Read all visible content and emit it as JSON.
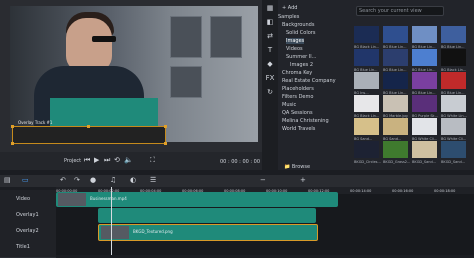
{
  "preview": {
    "frame_label": "Overlay Track #1",
    "project_label": "Project",
    "timecode": "00 : 00 : 00 : 00"
  },
  "library": {
    "add_label": "Add",
    "search_placeholder": "Search your current view",
    "tree": [
      "Samples",
      "Backgrounds",
      "Solid Colors",
      "Images",
      "Videos",
      "Summer Il...",
      "Images 2",
      "Chroma Key",
      "Real Estate Company",
      "Placeholders",
      "Filters Demo",
      "Music",
      "QA Sessions",
      "Melina Christening",
      "World Travels"
    ],
    "selected": "Images",
    "thumbs": [
      {
        "label": "BG Black Lin...",
        "color": "#1b2c54"
      },
      {
        "label": "BG Blue Lin...",
        "color": "#2f4f8f"
      },
      {
        "label": "BG Blue Lin...",
        "color": "#6f8fc4"
      },
      {
        "label": "BG Blue Lin...",
        "color": "#3e5f9e"
      },
      {
        "label": "BG Blue Lin...",
        "color": "#21366a"
      },
      {
        "label": "BG Blue Lin...",
        "color": "#2c3e6e"
      },
      {
        "label": "BG Blue Lin...",
        "color": "#4d7fd0"
      },
      {
        "label": "BG Black Lin...",
        "color": "#111"
      },
      {
        "label": "BG Ins...",
        "color": "#aab0b8"
      },
      {
        "label": "BG Blue Lin...",
        "color": "#15254a"
      },
      {
        "label": "BG Blue Lin...",
        "color": "#7a3fa0"
      },
      {
        "label": "BG Blue Lin...",
        "color": "#c02a2a"
      },
      {
        "label": "BG Black Lin...",
        "color": "#e7e7e9"
      },
      {
        "label": "BG Marble.jpg",
        "color": "#c9c1b4"
      },
      {
        "label": "BG Purple Sk...",
        "color": "#5a2f7a"
      },
      {
        "label": "BG White Lin...",
        "color": "#c8ccd2"
      },
      {
        "label": "BG Sand...",
        "color": "#d6c08a"
      },
      {
        "label": "BG Sand...",
        "color": "#c9b280"
      },
      {
        "label": "BG White Cli...",
        "color": "#e2e4e8"
      },
      {
        "label": "BG White Cli...",
        "color": "#b8bcc2"
      },
      {
        "label": "BKGD_Circles...",
        "color": "#1d2233"
      },
      {
        "label": "BKGD_Grass2...",
        "color": "#3f7a2e"
      },
      {
        "label": "BKGD_Sand...",
        "color": "#cfc0a0"
      },
      {
        "label": "BKGD_Sand...",
        "color": "#2d4d6f"
      }
    ],
    "browse_label": "Browse"
  },
  "timeline": {
    "ruler": [
      "00:00:00:00",
      "00:00:02:00",
      "00:00:04:00",
      "00:00:06:00",
      "00:00:08:00",
      "00:00:10:00",
      "00:00:12:00",
      "00:00:14:00",
      "00:00:16:00",
      "00:00:18:00"
    ],
    "tracks": [
      {
        "name": "Video",
        "clip": "Businessman.mp4"
      },
      {
        "name": "Overlay1",
        "clip": ""
      },
      {
        "name": "Overlay2",
        "clip": "BKGD_Textured.png"
      },
      {
        "name": "Title1",
        "clip": ""
      }
    ]
  }
}
